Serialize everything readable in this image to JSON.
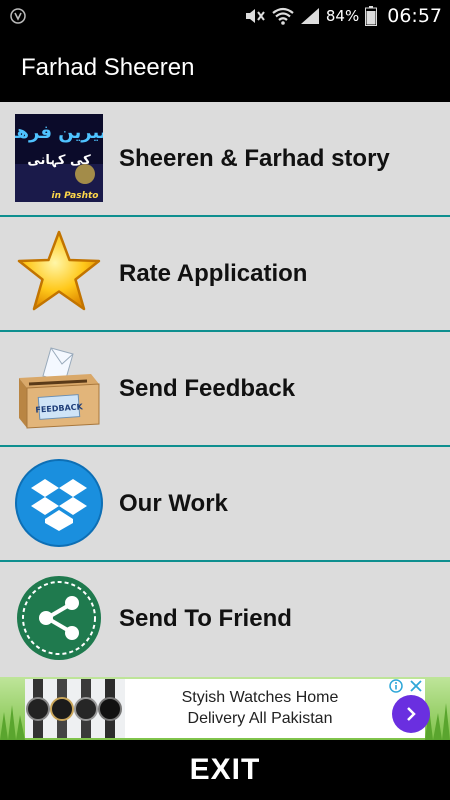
{
  "status_bar": {
    "battery_percent": "84%",
    "time": "06:57",
    "icons": [
      "shield-icon",
      "mute-icon",
      "wifi-icon",
      "signal-icon",
      "battery-icon"
    ]
  },
  "app": {
    "title": "Farhad Sheeren"
  },
  "menu": {
    "items": [
      {
        "label": "Sheeren & Farhad story",
        "icon": "story-thumbnail",
        "thumb_text_top": "شیرین فرهاد",
        "thumb_text_mid": "کی کہانی",
        "thumb_text_bottom": "in Pashto"
      },
      {
        "label": "Rate Application",
        "icon": "star-icon"
      },
      {
        "label": "Send Feedback",
        "icon": "feedback-box-icon",
        "box_text": "FEEDBACK"
      },
      {
        "label": "Our Work",
        "icon": "dropbox-icon"
      },
      {
        "label": "Send To Friend",
        "icon": "share-icon"
      }
    ],
    "divider_color": "#0e8f8f"
  },
  "ad": {
    "line1": "Styish Watches Home",
    "line2": "Delivery All Pakistan",
    "cta_color": "#6a2fe0"
  },
  "footer": {
    "exit_label": "EXIT"
  }
}
